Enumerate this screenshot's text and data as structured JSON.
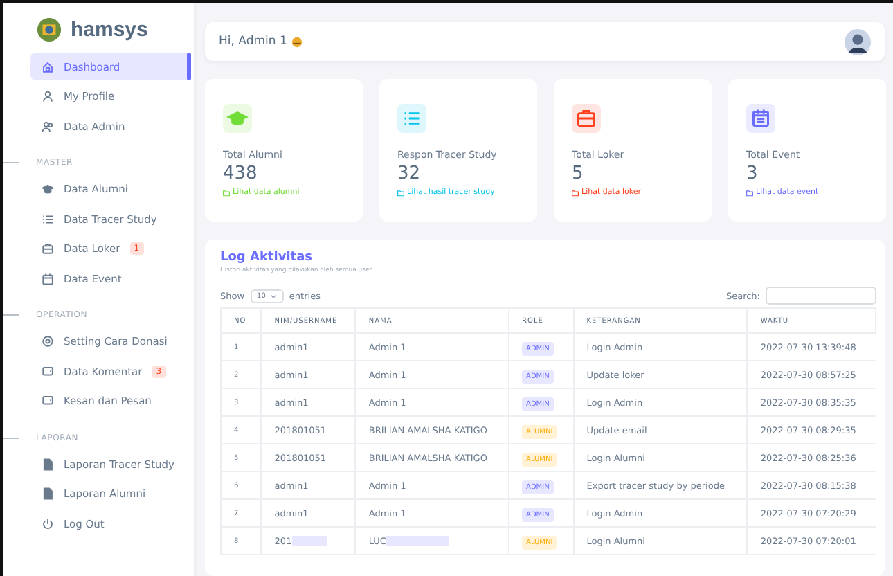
{
  "sidebar": {
    "brand": "hamsys",
    "sections": [
      {
        "items": [
          {
            "label": "Dashboard",
            "kind": "home",
            "selected": true
          },
          {
            "label": "My Profile",
            "kind": "user",
            "selected": false
          },
          {
            "label": "Data Admin",
            "kind": "users",
            "selected": false
          }
        ]
      },
      {
        "heading": "MASTER",
        "items": [
          {
            "label": "Data Alumni",
            "kind": "cap",
            "selected": false
          },
          {
            "label": "Data Tracer Study",
            "kind": "list",
            "selected": false
          },
          {
            "label": "Data Loker",
            "kind": "briefcase",
            "selected": false,
            "badge": "1"
          },
          {
            "label": "Data Event",
            "kind": "calendar",
            "selected": false
          }
        ]
      },
      {
        "heading": "OPERATION",
        "items": [
          {
            "label": "Setting Cara Donasi",
            "kind": "gear",
            "selected": false
          },
          {
            "label": "Data Komentar",
            "kind": "chat",
            "selected": false,
            "badge": "3"
          },
          {
            "label": "Kesan dan Pesan",
            "kind": "chat",
            "selected": false
          }
        ]
      },
      {
        "heading": "LAPORAN",
        "items": [
          {
            "label": "Laporan Tracer Study",
            "kind": "file",
            "selected": false
          },
          {
            "label": "Laporan Alumni",
            "kind": "file",
            "selected": false
          }
        ]
      },
      {
        "items": [
          {
            "label": "Log Out",
            "kind": "power",
            "selected": false
          }
        ]
      }
    ]
  },
  "header": {
    "greeting": "Hi, Admin 1"
  },
  "stats": [
    {
      "label": "Total Alumni",
      "value": "438",
      "link": "Lihat data alumni",
      "kind": "cap",
      "color": "#71dd37"
    },
    {
      "label": "Respon Tracer Study",
      "value": "32",
      "link": "Lihat hasil tracer study",
      "kind": "list",
      "color": "#03c3ec"
    },
    {
      "label": "Total Loker",
      "value": "5",
      "link": "Lihat data loker",
      "kind": "briefcase",
      "color": "#ff3e1d"
    },
    {
      "label": "Total Event",
      "value": "3",
      "link": "Lihat data event",
      "kind": "calendar",
      "color": "#696cff"
    }
  ],
  "log": {
    "title": "Log Aktivitas",
    "subtitle": "Histori aktivitas yang dilakukan oleh semua user",
    "show_label": "Show",
    "entries_value": "10",
    "entries_label": "entries",
    "search_label": "Search:",
    "columns": [
      "NO",
      "NIM/USERNAME",
      "NAMA",
      "ROLE",
      "KETERANGAN",
      "WAKTU"
    ],
    "rows": [
      {
        "no": "1",
        "user": "admin1",
        "name": "Admin 1",
        "role": "ADMIN",
        "kind": "admin",
        "info": "Login Admin",
        "time": "2022-07-30 13:39:48"
      },
      {
        "no": "2",
        "user": "admin1",
        "name": "Admin 1",
        "role": "ADMIN",
        "kind": "admin",
        "info": "Update loker",
        "time": "2022-07-30 08:57:25"
      },
      {
        "no": "3",
        "user": "admin1",
        "name": "Admin 1",
        "role": "ADMIN",
        "kind": "admin",
        "info": "Login Admin",
        "time": "2022-07-30 08:35:35"
      },
      {
        "no": "4",
        "user": "201801051",
        "name": "BRILIAN AMALSHA KATIGO",
        "role": "ALUMNI",
        "kind": "alumni",
        "info": "Update email",
        "time": "2022-07-30 08:29:35"
      },
      {
        "no": "5",
        "user": "201801051",
        "name": "BRILIAN AMALSHA KATIGO",
        "role": "ALUMNI",
        "kind": "alumni",
        "info": "Login Alumni",
        "time": "2022-07-30 08:25:36"
      },
      {
        "no": "6",
        "user": "admin1",
        "name": "Admin 1",
        "role": "ADMIN",
        "kind": "admin",
        "info": "Export tracer study by periode",
        "time": "2022-07-30 08:15:38"
      },
      {
        "no": "7",
        "user": "admin1",
        "name": "Admin 1",
        "role": "ADMIN",
        "kind": "admin",
        "info": "Login Admin",
        "time": "2022-07-30 07:20:29"
      },
      {
        "no": "8",
        "user": "201",
        "name": "LUC",
        "role": "ALUMNI",
        "kind": "alumni",
        "info": "Login Alumni",
        "time": "2022-07-30 07:20:01",
        "redacted": true
      }
    ]
  }
}
